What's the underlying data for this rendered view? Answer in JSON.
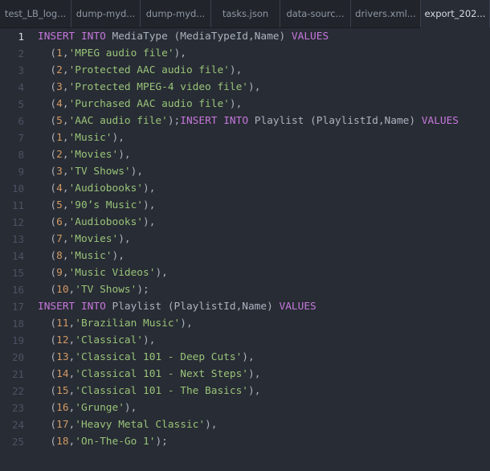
{
  "tabs": [
    {
      "label": "test_LB_log..."
    },
    {
      "label": "dump-myd..."
    },
    {
      "label": "dump-myd..."
    },
    {
      "label": "tasks.json"
    },
    {
      "label": "data-sourc..."
    },
    {
      "label": "drivers.xml..."
    },
    {
      "label": "export_202..."
    }
  ],
  "active_tab": 6,
  "current_line": 1,
  "lines": [
    [
      [
        "kw",
        "INSERT"
      ],
      [
        "pl",
        " "
      ],
      [
        "kw",
        "INTO"
      ],
      [
        "pl",
        " MediaType (MediaTypeId,Name) "
      ],
      [
        "kw",
        "VALUES"
      ]
    ],
    [
      [
        "pl",
        "  ("
      ],
      [
        "num",
        "1"
      ],
      [
        "pl",
        ","
      ],
      [
        "str",
        "'MPEG audio file'"
      ],
      [
        "pl",
        "),"
      ]
    ],
    [
      [
        "pl",
        "  ("
      ],
      [
        "num",
        "2"
      ],
      [
        "pl",
        ","
      ],
      [
        "str",
        "'Protected AAC audio file'"
      ],
      [
        "pl",
        "),"
      ]
    ],
    [
      [
        "pl",
        "  ("
      ],
      [
        "num",
        "3"
      ],
      [
        "pl",
        ","
      ],
      [
        "str",
        "'Protected MPEG-4 video file'"
      ],
      [
        "pl",
        "),"
      ]
    ],
    [
      [
        "pl",
        "  ("
      ],
      [
        "num",
        "4"
      ],
      [
        "pl",
        ","
      ],
      [
        "str",
        "'Purchased AAC audio file'"
      ],
      [
        "pl",
        "),"
      ]
    ],
    [
      [
        "pl",
        "  ("
      ],
      [
        "num",
        "5"
      ],
      [
        "pl",
        ","
      ],
      [
        "str",
        "'AAC audio file'"
      ],
      [
        "pl",
        ");"
      ],
      [
        "kw",
        "INSERT"
      ],
      [
        "pl",
        " "
      ],
      [
        "kw",
        "INTO"
      ],
      [
        "pl",
        " Playlist (PlaylistId,Name) "
      ],
      [
        "kw",
        "VALUES"
      ]
    ],
    [
      [
        "pl",
        "  ("
      ],
      [
        "num",
        "1"
      ],
      [
        "pl",
        ","
      ],
      [
        "str",
        "'Music'"
      ],
      [
        "pl",
        "),"
      ]
    ],
    [
      [
        "pl",
        "  ("
      ],
      [
        "num",
        "2"
      ],
      [
        "pl",
        ","
      ],
      [
        "str",
        "'Movies'"
      ],
      [
        "pl",
        "),"
      ]
    ],
    [
      [
        "pl",
        "  ("
      ],
      [
        "num",
        "3"
      ],
      [
        "pl",
        ","
      ],
      [
        "str",
        "'TV Shows'"
      ],
      [
        "pl",
        "),"
      ]
    ],
    [
      [
        "pl",
        "  ("
      ],
      [
        "num",
        "4"
      ],
      [
        "pl",
        ","
      ],
      [
        "str",
        "'Audiobooks'"
      ],
      [
        "pl",
        "),"
      ]
    ],
    [
      [
        "pl",
        "  ("
      ],
      [
        "num",
        "5"
      ],
      [
        "pl",
        ","
      ],
      [
        "str",
        "'90’s Music'"
      ],
      [
        "pl",
        "),"
      ]
    ],
    [
      [
        "pl",
        "  ("
      ],
      [
        "num",
        "6"
      ],
      [
        "pl",
        ","
      ],
      [
        "str",
        "'Audiobooks'"
      ],
      [
        "pl",
        "),"
      ]
    ],
    [
      [
        "pl",
        "  ("
      ],
      [
        "num",
        "7"
      ],
      [
        "pl",
        ","
      ],
      [
        "str",
        "'Movies'"
      ],
      [
        "pl",
        "),"
      ]
    ],
    [
      [
        "pl",
        "  ("
      ],
      [
        "num",
        "8"
      ],
      [
        "pl",
        ","
      ],
      [
        "str",
        "'Music'"
      ],
      [
        "pl",
        "),"
      ]
    ],
    [
      [
        "pl",
        "  ("
      ],
      [
        "num",
        "9"
      ],
      [
        "pl",
        ","
      ],
      [
        "str",
        "'Music Videos'"
      ],
      [
        "pl",
        "),"
      ]
    ],
    [
      [
        "pl",
        "  ("
      ],
      [
        "num",
        "10"
      ],
      [
        "pl",
        ","
      ],
      [
        "str",
        "'TV Shows'"
      ],
      [
        "pl",
        ");"
      ]
    ],
    [
      [
        "kw",
        "INSERT"
      ],
      [
        "pl",
        " "
      ],
      [
        "kw",
        "INTO"
      ],
      [
        "pl",
        " Playlist (PlaylistId,Name) "
      ],
      [
        "kw",
        "VALUES"
      ]
    ],
    [
      [
        "pl",
        "  ("
      ],
      [
        "num",
        "11"
      ],
      [
        "pl",
        ","
      ],
      [
        "str",
        "'Brazilian Music'"
      ],
      [
        "pl",
        "),"
      ]
    ],
    [
      [
        "pl",
        "  ("
      ],
      [
        "num",
        "12"
      ],
      [
        "pl",
        ","
      ],
      [
        "str",
        "'Classical'"
      ],
      [
        "pl",
        "),"
      ]
    ],
    [
      [
        "pl",
        "  ("
      ],
      [
        "num",
        "13"
      ],
      [
        "pl",
        ","
      ],
      [
        "str",
        "'Classical 101 - Deep Cuts'"
      ],
      [
        "pl",
        "),"
      ]
    ],
    [
      [
        "pl",
        "  ("
      ],
      [
        "num",
        "14"
      ],
      [
        "pl",
        ","
      ],
      [
        "str",
        "'Classical 101 - Next Steps'"
      ],
      [
        "pl",
        "),"
      ]
    ],
    [
      [
        "pl",
        "  ("
      ],
      [
        "num",
        "15"
      ],
      [
        "pl",
        ","
      ],
      [
        "str",
        "'Classical 101 - The Basics'"
      ],
      [
        "pl",
        "),"
      ]
    ],
    [
      [
        "pl",
        "  ("
      ],
      [
        "num",
        "16"
      ],
      [
        "pl",
        ","
      ],
      [
        "str",
        "'Grunge'"
      ],
      [
        "pl",
        "),"
      ]
    ],
    [
      [
        "pl",
        "  ("
      ],
      [
        "num",
        "17"
      ],
      [
        "pl",
        ","
      ],
      [
        "str",
        "'Heavy Metal Classic'"
      ],
      [
        "pl",
        "),"
      ]
    ],
    [
      [
        "pl",
        "  ("
      ],
      [
        "num",
        "18"
      ],
      [
        "pl",
        ","
      ],
      [
        "str",
        "'On-The-Go 1'"
      ],
      [
        "pl",
        ");"
      ]
    ]
  ],
  "colors": {
    "keyword": "#c678dd",
    "number": "#d19a66",
    "string": "#98c379",
    "plain": "#abb2bf",
    "background": "#282c34",
    "gutter": "#4b5263"
  }
}
